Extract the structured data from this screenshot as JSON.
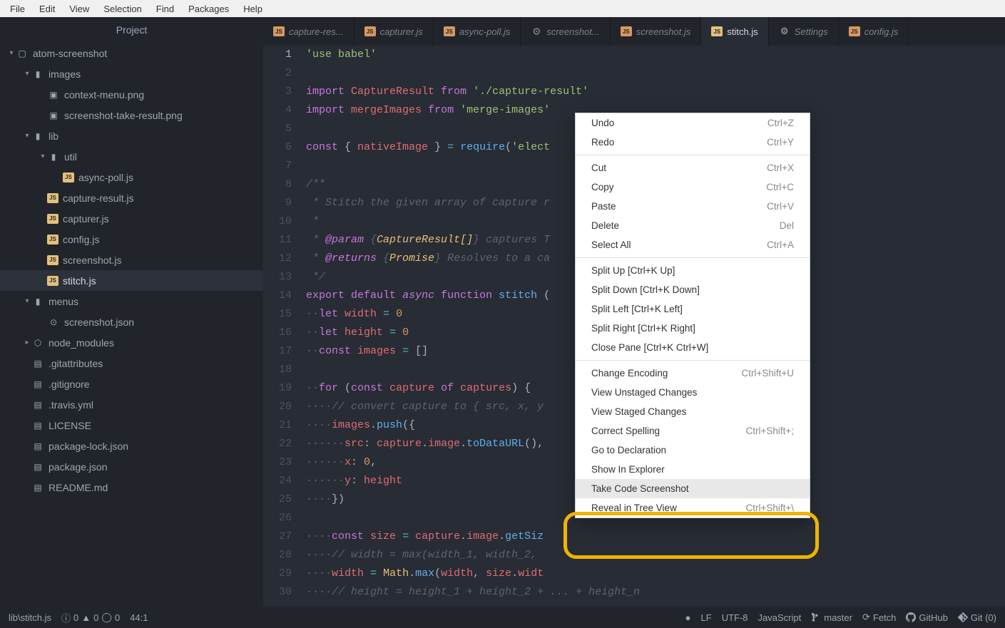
{
  "menubar": [
    "File",
    "Edit",
    "View",
    "Selection",
    "Find",
    "Packages",
    "Help"
  ],
  "sidebar": {
    "title": "Project",
    "tree": [
      {
        "depth": 0,
        "chev": "▾",
        "icon": "repo",
        "label": "atom-screenshot"
      },
      {
        "depth": 1,
        "chev": "▾",
        "icon": "folder",
        "label": "images"
      },
      {
        "depth": 2,
        "chev": "",
        "icon": "img",
        "label": "context-menu.png"
      },
      {
        "depth": 2,
        "chev": "",
        "icon": "img",
        "label": "screenshot-take-result.png"
      },
      {
        "depth": 1,
        "chev": "▾",
        "icon": "folder",
        "label": "lib"
      },
      {
        "depth": 2,
        "chev": "▾",
        "icon": "folder",
        "label": "util"
      },
      {
        "depth": 3,
        "chev": "",
        "icon": "js",
        "label": "async-poll.js"
      },
      {
        "depth": 2,
        "chev": "",
        "icon": "js",
        "label": "capture-result.js"
      },
      {
        "depth": 2,
        "chev": "",
        "icon": "js",
        "label": "capturer.js"
      },
      {
        "depth": 2,
        "chev": "",
        "icon": "js",
        "label": "config.js"
      },
      {
        "depth": 2,
        "chev": "",
        "icon": "js",
        "label": "screenshot.js"
      },
      {
        "depth": 2,
        "chev": "",
        "icon": "js",
        "label": "stitch.js",
        "active": true
      },
      {
        "depth": 1,
        "chev": "▾",
        "icon": "folder",
        "label": "menus"
      },
      {
        "depth": 2,
        "chev": "",
        "icon": "atom",
        "label": "screenshot.json"
      },
      {
        "depth": 1,
        "chev": "▸",
        "icon": "pkg",
        "label": "node_modules"
      },
      {
        "depth": 1,
        "chev": "",
        "icon": "file",
        "label": ".gitattributes"
      },
      {
        "depth": 1,
        "chev": "",
        "icon": "file",
        "label": ".gitignore"
      },
      {
        "depth": 1,
        "chev": "",
        "icon": "file",
        "label": ".travis.yml"
      },
      {
        "depth": 1,
        "chev": "",
        "icon": "file",
        "label": "LICENSE"
      },
      {
        "depth": 1,
        "chev": "",
        "icon": "file",
        "label": "package-lock.json"
      },
      {
        "depth": 1,
        "chev": "",
        "icon": "file",
        "label": "package.json"
      },
      {
        "depth": 1,
        "chev": "",
        "icon": "file",
        "label": "README.md"
      }
    ]
  },
  "tabs": [
    {
      "icon": "js",
      "label": "capture-res..."
    },
    {
      "icon": "js",
      "label": "capturer.js"
    },
    {
      "icon": "js",
      "label": "async-poll.js"
    },
    {
      "icon": "atom",
      "label": "screenshot..."
    },
    {
      "icon": "js",
      "label": "screenshot.js"
    },
    {
      "icon": "js",
      "label": "stitch.js",
      "active": true
    },
    {
      "icon": "gear",
      "label": "Settings"
    },
    {
      "icon": "js",
      "label": "config.js"
    }
  ],
  "code_lines": [
    [
      {
        "t": "'use babel'",
        "c": "c-str"
      }
    ],
    [],
    [
      {
        "t": "import",
        "c": "c-kw"
      },
      {
        "t": " "
      },
      {
        "t": "CaptureResult",
        "c": "c-var"
      },
      {
        "t": " "
      },
      {
        "t": "from",
        "c": "c-kw"
      },
      {
        "t": " "
      },
      {
        "t": "'./capture-result'",
        "c": "c-str"
      }
    ],
    [
      {
        "t": "import",
        "c": "c-kw"
      },
      {
        "t": " "
      },
      {
        "t": "mergeImages",
        "c": "c-var"
      },
      {
        "t": " "
      },
      {
        "t": "from",
        "c": "c-kw"
      },
      {
        "t": " "
      },
      {
        "t": "'merge-images'",
        "c": "c-str"
      }
    ],
    [],
    [
      {
        "t": "const",
        "c": "c-kw"
      },
      {
        "t": " { "
      },
      {
        "t": "nativeImage",
        "c": "c-var"
      },
      {
        "t": " } "
      },
      {
        "t": "=",
        "c": "c-op"
      },
      {
        "t": " "
      },
      {
        "t": "require",
        "c": "c-fn"
      },
      {
        "t": "("
      },
      {
        "t": "'elect",
        "c": "c-str"
      }
    ],
    [],
    [
      {
        "t": "/**",
        "c": "c-cmt"
      }
    ],
    [
      {
        "t": " * Stitch the given array of capture r",
        "c": "c-cmt"
      }
    ],
    [
      {
        "t": " *",
        "c": "c-cmt"
      }
    ],
    [
      {
        "t": " * ",
        "c": "c-cmt"
      },
      {
        "t": "@param",
        "c": "c-cmt-kw"
      },
      {
        "t": " {",
        "c": "c-cmt"
      },
      {
        "t": "CaptureResult[]",
        "c": "c-cmt-ty"
      },
      {
        "t": "} ",
        "c": "c-cmt"
      },
      {
        "t": "captures",
        "c": "c-cmt"
      },
      {
        "t": " T",
        "c": "c-cmt"
      }
    ],
    [
      {
        "t": " * ",
        "c": "c-cmt"
      },
      {
        "t": "@returns",
        "c": "c-cmt-kw"
      },
      {
        "t": " {",
        "c": "c-cmt"
      },
      {
        "t": "Promise",
        "c": "c-cmt-ty"
      },
      {
        "t": "} Resolves to a ca                                   ge.",
        "c": "c-cmt"
      }
    ],
    [
      {
        "t": " */",
        "c": "c-cmt"
      }
    ],
    [
      {
        "t": "export",
        "c": "c-kw"
      },
      {
        "t": " "
      },
      {
        "t": "default",
        "c": "c-kw"
      },
      {
        "t": " "
      },
      {
        "t": "async",
        "c": "c-kw2"
      },
      {
        "t": " "
      },
      {
        "t": "function",
        "c": "c-kw"
      },
      {
        "t": " "
      },
      {
        "t": "stitch",
        "c": "c-fn"
      },
      {
        "t": " ("
      }
    ],
    [
      {
        "t": "··",
        "c": "c-inv"
      },
      {
        "t": "let",
        "c": "c-kw"
      },
      {
        "t": " "
      },
      {
        "t": "width",
        "c": "c-var"
      },
      {
        "t": " "
      },
      {
        "t": "=",
        "c": "c-op"
      },
      {
        "t": " "
      },
      {
        "t": "0",
        "c": "c-num"
      }
    ],
    [
      {
        "t": "··",
        "c": "c-inv"
      },
      {
        "t": "let",
        "c": "c-kw"
      },
      {
        "t": " "
      },
      {
        "t": "height",
        "c": "c-var"
      },
      {
        "t": " "
      },
      {
        "t": "=",
        "c": "c-op"
      },
      {
        "t": " "
      },
      {
        "t": "0",
        "c": "c-num"
      }
    ],
    [
      {
        "t": "··",
        "c": "c-inv"
      },
      {
        "t": "const",
        "c": "c-kw"
      },
      {
        "t": " "
      },
      {
        "t": "images",
        "c": "c-var"
      },
      {
        "t": " "
      },
      {
        "t": "=",
        "c": "c-op"
      },
      {
        "t": " []"
      }
    ],
    [],
    [
      {
        "t": "··",
        "c": "c-inv"
      },
      {
        "t": "for",
        "c": "c-kw"
      },
      {
        "t": " ("
      },
      {
        "t": "const",
        "c": "c-kw"
      },
      {
        "t": " "
      },
      {
        "t": "capture",
        "c": "c-var"
      },
      {
        "t": " "
      },
      {
        "t": "of",
        "c": "c-kw"
      },
      {
        "t": " "
      },
      {
        "t": "captures",
        "c": "c-var"
      },
      {
        "t": ") {"
      }
    ],
    [
      {
        "t": "····",
        "c": "c-inv"
      },
      {
        "t": "// convert capture to { src, x, y ",
        "c": "c-cmt"
      }
    ],
    [
      {
        "t": "····",
        "c": "c-inv"
      },
      {
        "t": "images",
        "c": "c-var"
      },
      {
        "t": "."
      },
      {
        "t": "push",
        "c": "c-fn"
      },
      {
        "t": "({"
      }
    ],
    [
      {
        "t": "······",
        "c": "c-inv"
      },
      {
        "t": "src",
        "c": "c-var"
      },
      {
        "t": ": "
      },
      {
        "t": "capture",
        "c": "c-var"
      },
      {
        "t": "."
      },
      {
        "t": "image",
        "c": "c-var"
      },
      {
        "t": "."
      },
      {
        "t": "toDataURL",
        "c": "c-fn"
      },
      {
        "t": "(),"
      }
    ],
    [
      {
        "t": "······",
        "c": "c-inv"
      },
      {
        "t": "x",
        "c": "c-var"
      },
      {
        "t": ": "
      },
      {
        "t": "0",
        "c": "c-num"
      },
      {
        "t": ","
      }
    ],
    [
      {
        "t": "······",
        "c": "c-inv"
      },
      {
        "t": "y",
        "c": "c-var"
      },
      {
        "t": ": "
      },
      {
        "t": "height",
        "c": "c-var"
      }
    ],
    [
      {
        "t": "····",
        "c": "c-inv"
      },
      {
        "t": "})"
      }
    ],
    [],
    [
      {
        "t": "····",
        "c": "c-inv"
      },
      {
        "t": "const",
        "c": "c-kw"
      },
      {
        "t": " "
      },
      {
        "t": "size",
        "c": "c-var"
      },
      {
        "t": " "
      },
      {
        "t": "=",
        "c": "c-op"
      },
      {
        "t": " "
      },
      {
        "t": "capture",
        "c": "c-var"
      },
      {
        "t": "."
      },
      {
        "t": "image",
        "c": "c-var"
      },
      {
        "t": "."
      },
      {
        "t": "getSiz",
        "c": "c-fn"
      }
    ],
    [
      {
        "t": "····",
        "c": "c-inv"
      },
      {
        "t": "// width = max(width_1, width_2, ",
        "c": "c-cmt"
      }
    ],
    [
      {
        "t": "····",
        "c": "c-inv"
      },
      {
        "t": "width",
        "c": "c-var"
      },
      {
        "t": " "
      },
      {
        "t": "=",
        "c": "c-op"
      },
      {
        "t": " "
      },
      {
        "t": "Math",
        "c": "c-cls"
      },
      {
        "t": "."
      },
      {
        "t": "max",
        "c": "c-fn"
      },
      {
        "t": "("
      },
      {
        "t": "width",
        "c": "c-var"
      },
      {
        "t": ", "
      },
      {
        "t": "size",
        "c": "c-var"
      },
      {
        "t": "."
      },
      {
        "t": "widt",
        "c": "c-var"
      }
    ],
    [
      {
        "t": "····",
        "c": "c-inv"
      },
      {
        "t": "// height = height_1 + height_2 + ... + height_n",
        "c": "c-cmt"
      }
    ]
  ],
  "context_menu": [
    {
      "label": "Undo",
      "shortcut": "Ctrl+Z"
    },
    {
      "label": "Redo",
      "shortcut": "Ctrl+Y"
    },
    {
      "sep": true
    },
    {
      "label": "Cut",
      "shortcut": "Ctrl+X"
    },
    {
      "label": "Copy",
      "shortcut": "Ctrl+C"
    },
    {
      "label": "Paste",
      "shortcut": "Ctrl+V"
    },
    {
      "label": "Delete",
      "shortcut": "Del"
    },
    {
      "label": "Select All",
      "shortcut": "Ctrl+A"
    },
    {
      "sep": true
    },
    {
      "label": "Split Up [Ctrl+K Up]"
    },
    {
      "label": "Split Down [Ctrl+K Down]"
    },
    {
      "label": "Split Left [Ctrl+K Left]"
    },
    {
      "label": "Split Right [Ctrl+K Right]"
    },
    {
      "label": "Close Pane [Ctrl+K Ctrl+W]"
    },
    {
      "sep": true
    },
    {
      "label": "Change Encoding",
      "shortcut": "Ctrl+Shift+U"
    },
    {
      "label": "View Unstaged Changes"
    },
    {
      "label": "View Staged Changes"
    },
    {
      "label": "Correct Spelling",
      "shortcut": "Ctrl+Shift+;"
    },
    {
      "label": "Go to Declaration"
    },
    {
      "label": "Show In Explorer"
    },
    {
      "label": "Take Code Screenshot",
      "hover": true
    },
    {
      "label": "Reveal in Tree View",
      "shortcut": "Ctrl+Shift+\\"
    }
  ],
  "statusbar": {
    "path": "lib\\stitch.js",
    "diag": "0",
    "diag2": "0",
    "diag3": "0",
    "cursor": "44:1",
    "lf": "LF",
    "encoding": "UTF-8",
    "lang": "JavaScript",
    "branch": "master",
    "fetch": "Fetch",
    "github": "GitHub",
    "git": "Git (0)"
  }
}
